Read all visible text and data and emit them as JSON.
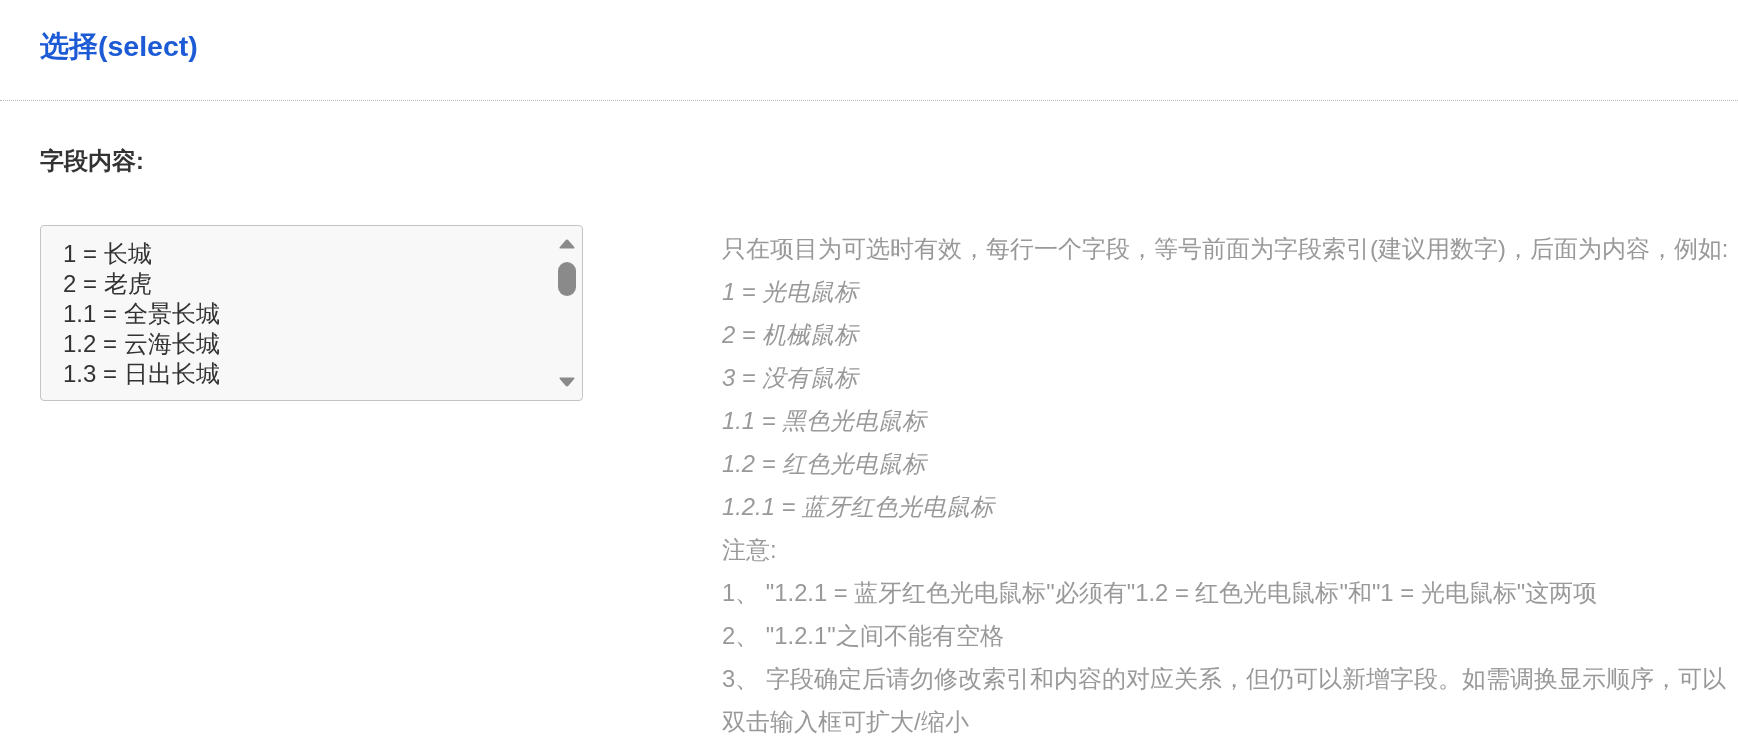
{
  "header": {
    "title": "选择(select)"
  },
  "field": {
    "label": "字段内容:",
    "value_lines": [
      "1 = 长城",
      "2 = 老虎",
      "1.1 = 全景长城",
      "1.2 = 云海长城",
      "1.3 = 日出长城"
    ]
  },
  "help": {
    "lines": [
      {
        "kind": "plain",
        "text": "只在项目为可选时有效，每行一个字段，等号前面为字段索引(建议用数字)，后面为内容，例如:"
      },
      {
        "kind": "example",
        "text": "1 = 光电鼠标"
      },
      {
        "kind": "example",
        "text": "2 = 机械鼠标"
      },
      {
        "kind": "example",
        "text": "3 = 没有鼠标"
      },
      {
        "kind": "example",
        "text": "1.1 = 黑色光电鼠标"
      },
      {
        "kind": "example",
        "text": "1.2 = 红色光电鼠标"
      },
      {
        "kind": "example",
        "text": "1.2.1 = 蓝牙红色光电鼠标"
      },
      {
        "kind": "plain",
        "text": "注意:"
      },
      {
        "kind": "plain",
        "text": "1、 \"1.2.1 = 蓝牙红色光电鼠标\"必须有\"1.2 = 红色光电鼠标\"和\"1 = 光电鼠标\"这两项"
      },
      {
        "kind": "plain",
        "text": "2、 \"1.2.1\"之间不能有空格"
      },
      {
        "kind": "plain",
        "text": "3、 字段确定后请勿修改索引和内容的对应关系，但仍可以新增字段。如需调换显示顺序，可以"
      },
      {
        "kind": "plain",
        "text": "双击输入框可扩大/缩小"
      }
    ]
  }
}
